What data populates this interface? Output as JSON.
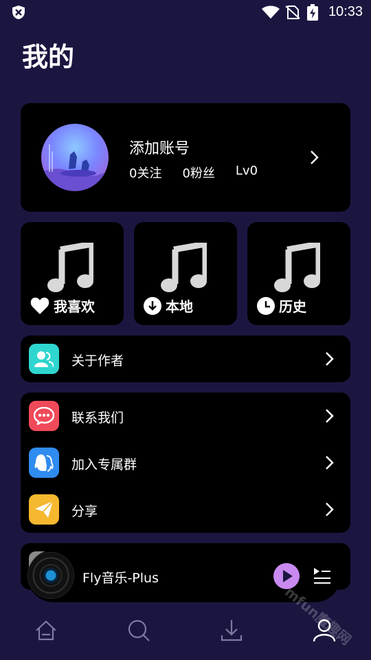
{
  "status_bar": {
    "time": "10:33"
  },
  "page_title": "我的",
  "profile": {
    "name": "添加账号",
    "following": "0关注",
    "followers": "0粉丝",
    "level": "Lv0"
  },
  "quick_actions": [
    {
      "label": "我喜欢",
      "icon": "heart-icon"
    },
    {
      "label": "本地",
      "icon": "download-circle-icon"
    },
    {
      "label": "历史",
      "icon": "clock-icon"
    }
  ],
  "menu": {
    "about": {
      "label": "关于作者",
      "icon": "contacts-icon",
      "color": "#2fd6cf"
    },
    "contact": {
      "label": "联系我们",
      "icon": "chat-bubble-icon",
      "color": "#f04a5a"
    },
    "group": {
      "label": "加入专属群",
      "icon": "qq-group-icon",
      "color": "#2f8cf0"
    },
    "share": {
      "label": "分享",
      "icon": "paper-plane-icon",
      "color": "#f5b82e"
    }
  },
  "player": {
    "title": "Fly音乐-Plus",
    "accent": "#c98af0"
  },
  "bottom_nav": [
    {
      "name": "home",
      "icon": "home-icon"
    },
    {
      "name": "search",
      "icon": "search-icon"
    },
    {
      "name": "download",
      "icon": "download-icon"
    },
    {
      "name": "profile",
      "icon": "user-icon",
      "active": true
    }
  ],
  "watermark": "mfun魔趣网"
}
